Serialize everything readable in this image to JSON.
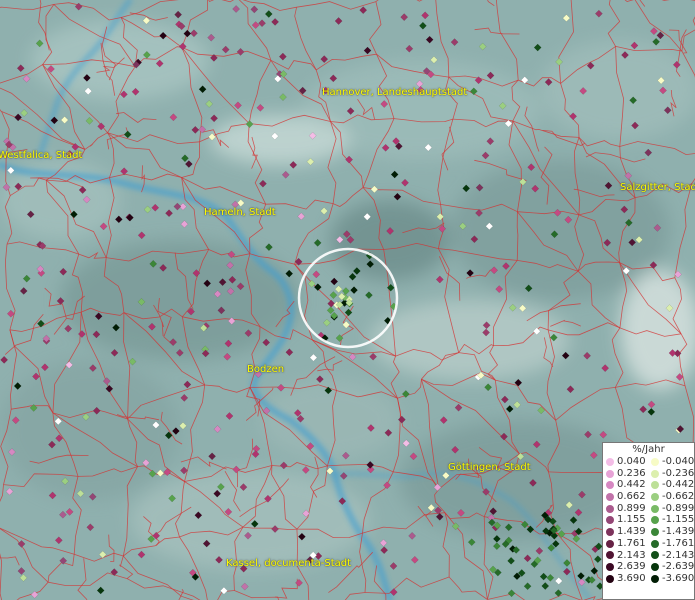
{
  "map": {
    "cities": [
      {
        "label": "Hannover, Landeshauptstadt"
      },
      {
        "label": "Westfalica, Stadt"
      },
      {
        "label": "Hameln, Stadt"
      },
      {
        "label": "Salzgitter, Stadt"
      },
      {
        "label": "Bodzen"
      },
      {
        "label": "Göttingen, Stadt"
      },
      {
        "label": "Kassel, documenta-Stadt"
      }
    ],
    "colors": {
      "terrain_base": "#8fb0ae",
      "river": "#3f9fd2",
      "boundary": "#d43030",
      "city_label": "#ffff00",
      "highlight_ring": "#ffffff"
    }
  },
  "legend": {
    "title": "%/Jahr",
    "positive": [
      {
        "value": "0.040",
        "color": "#f3bde6"
      },
      {
        "value": "0.236",
        "color": "#e7a3d6"
      },
      {
        "value": "0.442",
        "color": "#d688c2"
      },
      {
        "value": "0.662",
        "color": "#c172a9"
      },
      {
        "value": "0.899",
        "color": "#ab5b8e"
      },
      {
        "value": "1.155",
        "color": "#944675"
      },
      {
        "value": "1.439",
        "color": "#7d335c"
      },
      {
        "value": "1.761",
        "color": "#662245"
      },
      {
        "value": "2.143",
        "color": "#501433"
      },
      {
        "value": "2.639",
        "color": "#3b0823"
      },
      {
        "value": "3.690",
        "color": "#240212"
      }
    ],
    "negative": [
      {
        "value": "-0.040",
        "color": "#f7fbc6"
      },
      {
        "value": "-0.236",
        "color": "#dcefae"
      },
      {
        "value": "-0.442",
        "color": "#bde098"
      },
      {
        "value": "-0.662",
        "color": "#9bcf81"
      },
      {
        "value": "-0.899",
        "color": "#79ba66"
      },
      {
        "value": "-1.155",
        "color": "#57a24c"
      },
      {
        "value": "-1.439",
        "color": "#3b8638"
      },
      {
        "value": "-1.761",
        "color": "#256a28"
      },
      {
        "value": "-2.143",
        "color": "#124e18"
      },
      {
        "value": "-2.639",
        "color": "#06360c"
      },
      {
        "value": "-3.690",
        "color": "#011d04"
      }
    ]
  }
}
